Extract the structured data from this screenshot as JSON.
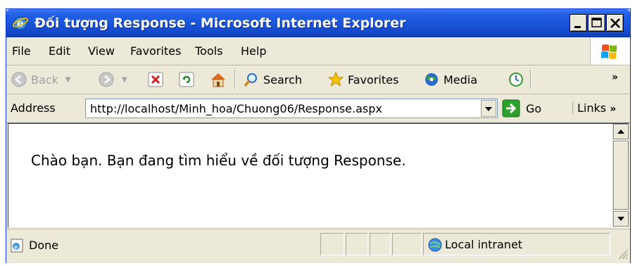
{
  "window": {
    "title": "Đối tượng Response - Microsoft Internet Explorer",
    "icon": "ie-icon"
  },
  "menu": [
    {
      "label": "File"
    },
    {
      "label": "Edit"
    },
    {
      "label": "View"
    },
    {
      "label": "Favorites"
    },
    {
      "label": "Tools"
    },
    {
      "label": "Help"
    }
  ],
  "toolbar": {
    "back_label": "Back",
    "search_label": "Search",
    "favorites_label": "Favorites",
    "media_label": "Media",
    "more": "»"
  },
  "address": {
    "label": "Address",
    "value": "http://localhost/Minh_hoa/Chuong06/Response.aspx",
    "go_label": "Go",
    "links_label": "Links",
    "links_more": "»"
  },
  "content": {
    "text": "Chào bạn. Bạn đang tìm hiểu về đối tượng Response."
  },
  "status": {
    "text": "Done",
    "zone": "Local intranet"
  },
  "colors": {
    "titlebar": "#1a55dc",
    "chrome": "#ece9d8",
    "go_green": "#2da02d"
  }
}
